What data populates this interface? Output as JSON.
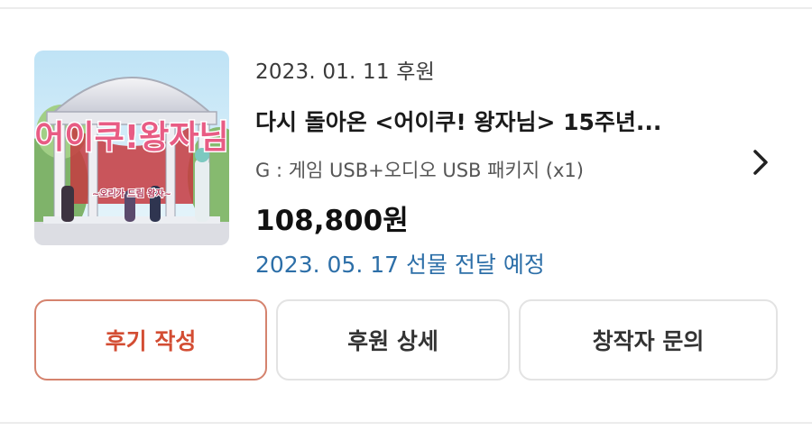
{
  "order": {
    "pledge_date": "2023. 01. 11 후원",
    "title": "다시 돌아온 <어이쿠! 왕자님> 15주년...",
    "option": "G : 게임 USB+오디오 USB 패키지 (x1)",
    "price": "108,800원",
    "delivery": "2023. 05. 17 선물 전달 예정",
    "thumbnail": {
      "title_text": "어이쿠!왕자님",
      "subtitle_text": "~오리가 드림 왕자~"
    }
  },
  "actions": {
    "review_label": "후기 작성",
    "detail_label": "후원 상세",
    "contact_label": "창작자 문의"
  },
  "icons": {
    "chevron": "chevron-right-icon"
  },
  "colors": {
    "review_accent": "#d34d33",
    "review_border": "#d5836e",
    "delivery_text": "#2d6fa8",
    "neutral_border": "#e3e3e3"
  }
}
